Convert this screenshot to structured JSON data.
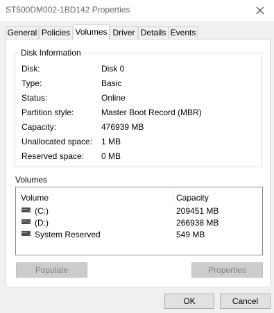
{
  "window": {
    "title": "ST500DM002-1BD142 Properties"
  },
  "tabs": [
    {
      "label": "General"
    },
    {
      "label": "Policies"
    },
    {
      "label": "Volumes"
    },
    {
      "label": "Driver"
    },
    {
      "label": "Details"
    },
    {
      "label": "Events"
    }
  ],
  "disk_info": {
    "title": "Disk Information",
    "rows": [
      {
        "label": "Disk:",
        "value": "Disk 0"
      },
      {
        "label": "Type:",
        "value": "Basic"
      },
      {
        "label": "Status:",
        "value": "Online"
      },
      {
        "label": "Partition style:",
        "value": "Master Boot Record (MBR)"
      },
      {
        "label": "Capacity:",
        "value": "476939 MB"
      },
      {
        "label": "Unallocated space:",
        "value": "1 MB"
      },
      {
        "label": "Reserved space:",
        "value": "0 MB"
      }
    ]
  },
  "volumes": {
    "heading": "Volumes",
    "columns": {
      "volume": "Volume",
      "capacity": "Capacity"
    },
    "rows": [
      {
        "name": "(C:)",
        "capacity": "209451 MB",
        "icon": "drive-icon"
      },
      {
        "name": "(D:)",
        "capacity": "266938 MB",
        "icon": "drive-icon"
      },
      {
        "name": "System Reserved",
        "capacity": "549 MB",
        "icon": "drive-icon"
      }
    ]
  },
  "buttons": {
    "populate": "Populate",
    "properties": "Properties",
    "ok": "OK",
    "cancel": "Cancel"
  }
}
